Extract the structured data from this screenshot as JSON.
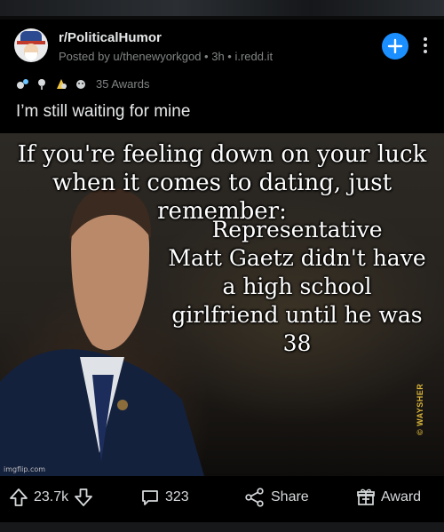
{
  "post": {
    "subreddit": "r/PoliticalHumor",
    "meta": "Posted by u/thenewyorkgod • 3h • i.redd.it",
    "awards_count": "35 Awards",
    "title": "I’m still waiting for mine"
  },
  "meme": {
    "top_text": "If you're feeling down on your luck\nwhen it comes to dating, just remember:",
    "body_text": "Representative\nMatt Gaetz didn't have\na high school\ngirlfriend until he was 38",
    "watermark_left": "imgflip.com",
    "watermark_right": "© WAYSHER"
  },
  "actions": {
    "upvotes": "23.7k",
    "comments": "323",
    "share": "Share",
    "award": "Award"
  },
  "colors": {
    "background": "#000000",
    "join_button": "#1b8fff",
    "muted_text": "#818384"
  },
  "icons": [
    "avatar",
    "plus-icon",
    "more-vertical-icon",
    "award-icons",
    "upvote-icon",
    "downvote-icon",
    "comment-icon",
    "share-icon",
    "gift-icon"
  ]
}
